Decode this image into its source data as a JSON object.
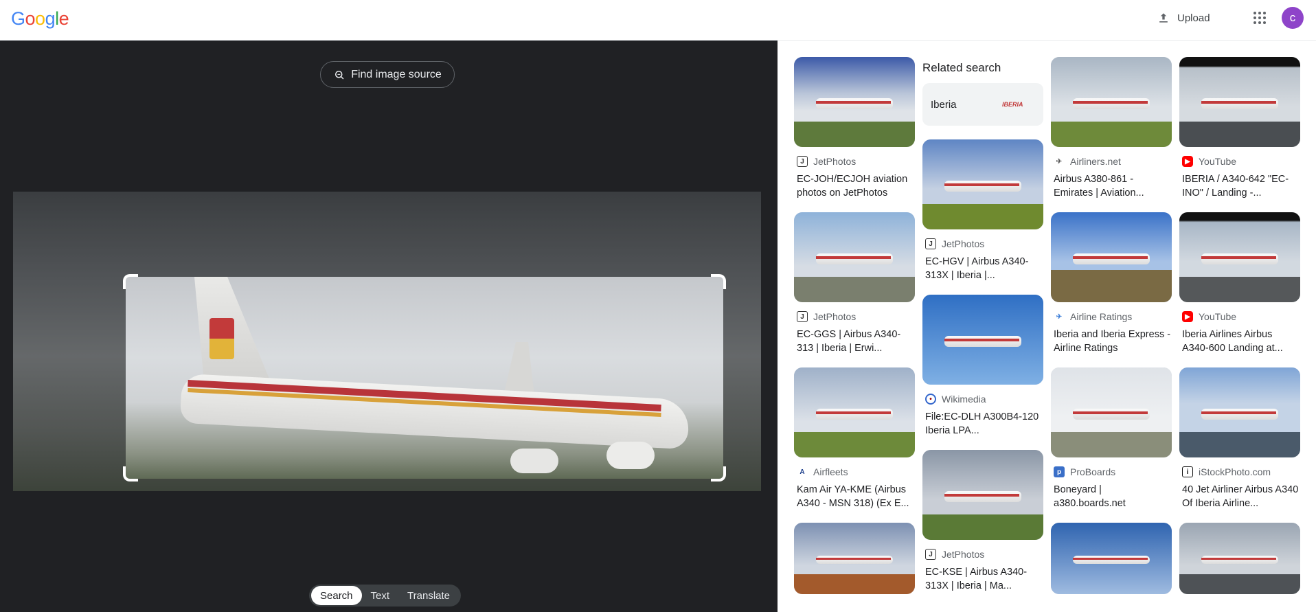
{
  "header": {
    "logo": "Google",
    "upload_label": "Upload",
    "avatar_letter": "c"
  },
  "viewer": {
    "find_source_label": "Find image source",
    "modes": [
      "Search",
      "Text",
      "Translate"
    ],
    "active_mode": "Search"
  },
  "results": {
    "related_heading": "Related search",
    "related_chip": "Iberia",
    "related_chip_logo": "IBERIA",
    "col1": [
      {
        "source": "JetPhotos",
        "title": "EC-JOH/ECJOH aviation photos on JetPhotos"
      },
      {
        "source": "JetPhotos",
        "title": "EC-GGS | Airbus A340-313 | Iberia | Erwi..."
      },
      {
        "source": "Airfleets",
        "title": "Kam Air YA-KME (Airbus A340 - MSN 318) (Ex E..."
      },
      {
        "source": "",
        "title": ""
      }
    ],
    "col2": [
      {
        "source": "JetPhotos",
        "title": "EC-HGV | Airbus A340-313X | Iberia |..."
      },
      {
        "source": "Wikimedia",
        "title": "File:EC-DLH A300B4-120 Iberia LPA..."
      },
      {
        "source": "JetPhotos",
        "title": "EC-KSE | Airbus A340-313X | Iberia | Ma..."
      }
    ],
    "col3": [
      {
        "source": "Airliners.net",
        "title": "Airbus A380-861 - Emirates | Aviation..."
      },
      {
        "source": "Airline Ratings",
        "title": "Iberia and Iberia Express - Airline Ratings"
      },
      {
        "source": "ProBoards",
        "title": "Boneyard | a380.boards.net"
      },
      {
        "source": "",
        "title": ""
      }
    ],
    "col4": [
      {
        "source": "YouTube",
        "title": "IBERIA / A340-642 \"EC-INO\" / Landing -..."
      },
      {
        "source": "YouTube",
        "title": "Iberia Airlines Airbus A340-600 Landing at..."
      },
      {
        "source": "iStockPhoto.com",
        "title": "40 Jet Airliner Airbus A340 Of Iberia Airline..."
      },
      {
        "source": "",
        "title": ""
      }
    ]
  }
}
